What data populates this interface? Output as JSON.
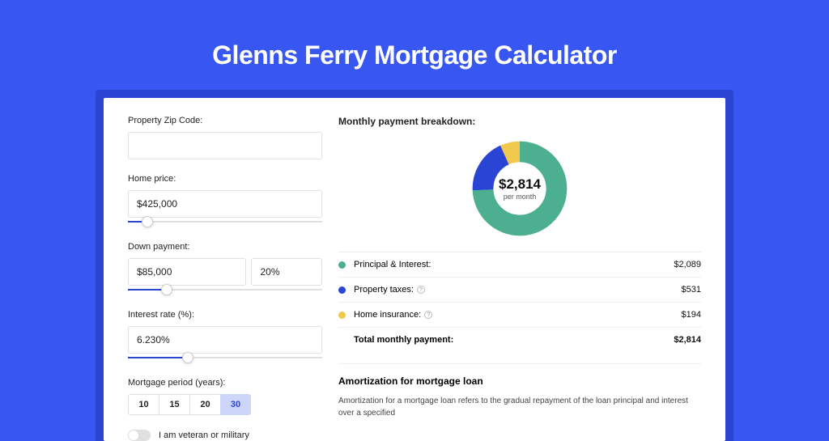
{
  "page_title": "Glenns Ferry Mortgage Calculator",
  "form": {
    "zip_label": "Property Zip Code:",
    "zip_value": "",
    "home_price_label": "Home price:",
    "home_price_value": "$425,000",
    "home_price_slider_pct": 10,
    "down_label": "Down payment:",
    "down_amount": "$85,000",
    "down_pct": "20%",
    "down_slider_pct": 20,
    "rate_label": "Interest rate (%):",
    "rate_value": "6.230%",
    "rate_slider_pct": 31,
    "period_label": "Mortgage period (years):",
    "period_options": [
      "10",
      "15",
      "20",
      "30"
    ],
    "period_selected": "30",
    "veteran_label": "I am veteran or military"
  },
  "breakdown": {
    "title": "Monthly payment breakdown:",
    "center_amount": "$2,814",
    "center_sub": "per month",
    "items": [
      {
        "label": "Principal & Interest:",
        "value": "$2,089",
        "color": "#4caf8f",
        "info": false
      },
      {
        "label": "Property taxes:",
        "value": "$531",
        "color": "#2a44d4",
        "info": true
      },
      {
        "label": "Home insurance:",
        "value": "$194",
        "color": "#f1c94c",
        "info": true
      }
    ],
    "total_label": "Total monthly payment:",
    "total_value": "$2,814"
  },
  "chart_data": {
    "type": "pie",
    "title": "Monthly payment breakdown",
    "series": [
      {
        "name": "Principal & Interest",
        "value": 2089,
        "color": "#4caf8f"
      },
      {
        "name": "Property taxes",
        "value": 531,
        "color": "#2a44d4"
      },
      {
        "name": "Home insurance",
        "value": 194,
        "color": "#f1c94c"
      }
    ],
    "total": 2814
  },
  "amort": {
    "title": "Amortization for mortgage loan",
    "text": "Amortization for a mortgage loan refers to the gradual repayment of the loan principal and interest over a specified"
  }
}
